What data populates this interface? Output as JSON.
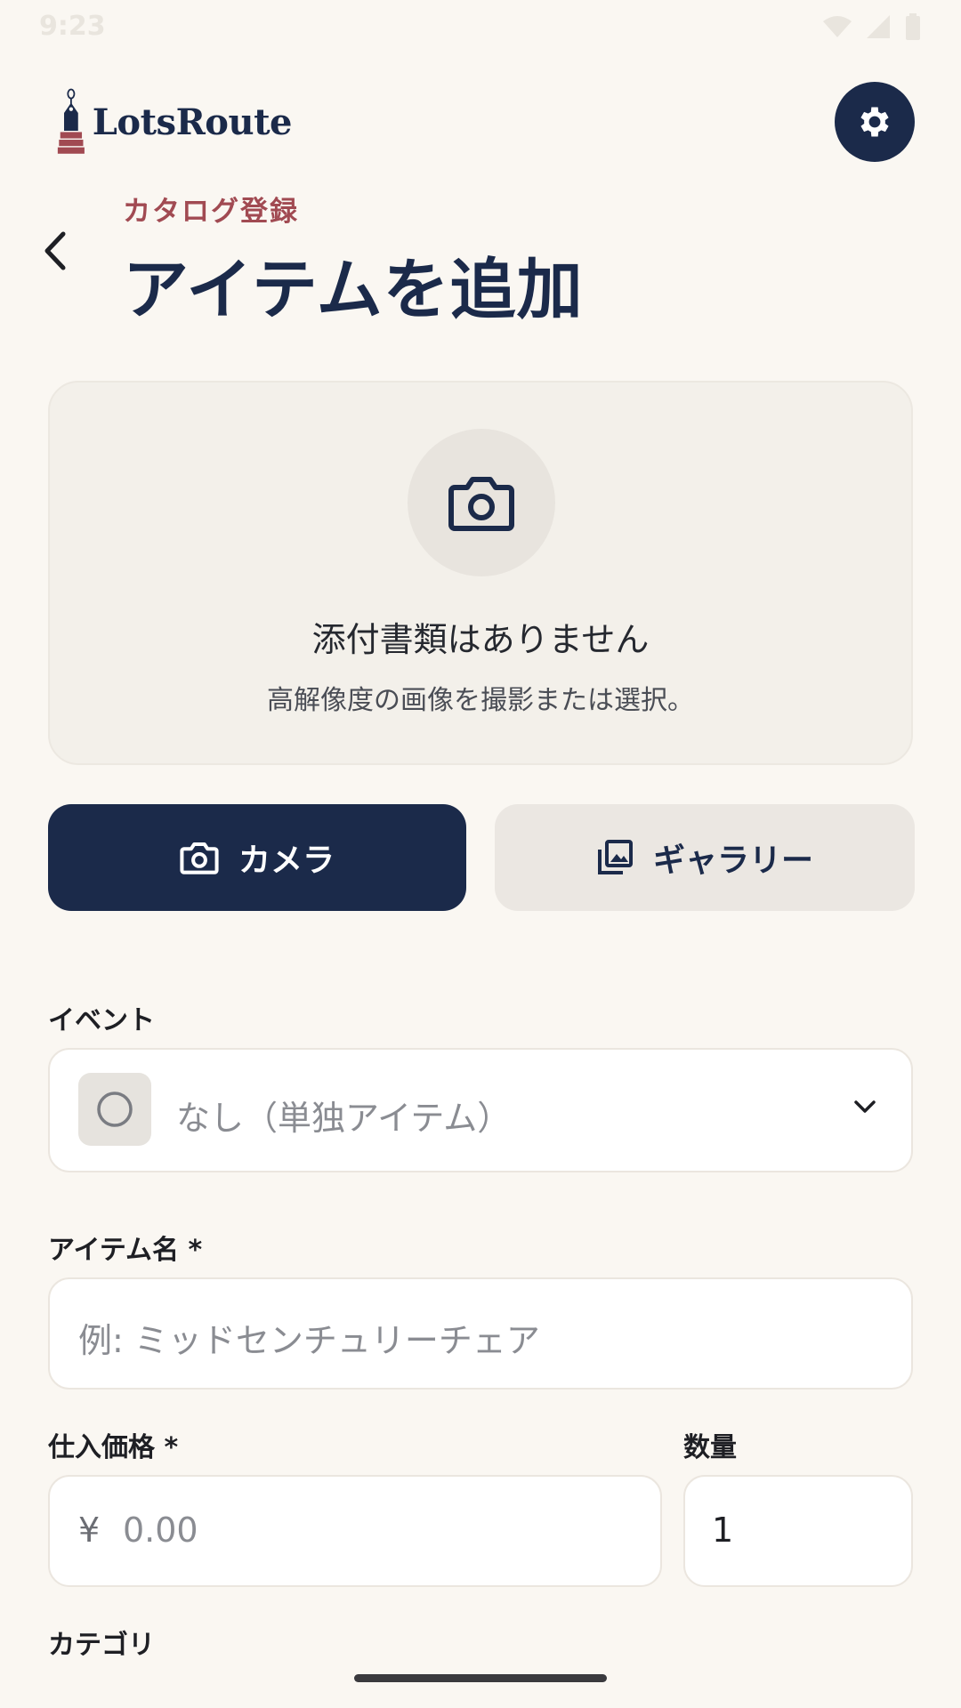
{
  "status_bar": {
    "time": "9:23"
  },
  "header": {
    "logo_text": "LotsRoute",
    "subtitle": "カタログ登録",
    "title": "アイテムを追加"
  },
  "photo": {
    "empty_text": "添付書類はありません",
    "hint": "高解像度の画像を撮影または選択。"
  },
  "actions": {
    "camera_label": "カメラ",
    "gallery_label": "ギャラリー"
  },
  "form": {
    "event_label": "イベント",
    "event_value": "なし（単独アイテム）",
    "name_label": "アイテム名 *",
    "name_placeholder": "例: ミッドセンチュリーチェア",
    "price_label": "仕入価格 *",
    "price_currency": "¥",
    "price_placeholder": "0.00",
    "quantity_label": "数量",
    "quantity_value": "1",
    "category_label": "カテゴリ"
  },
  "colors": {
    "primary": "#1b2a4a",
    "accent": "#a14a52",
    "background": "#faf7f2"
  }
}
